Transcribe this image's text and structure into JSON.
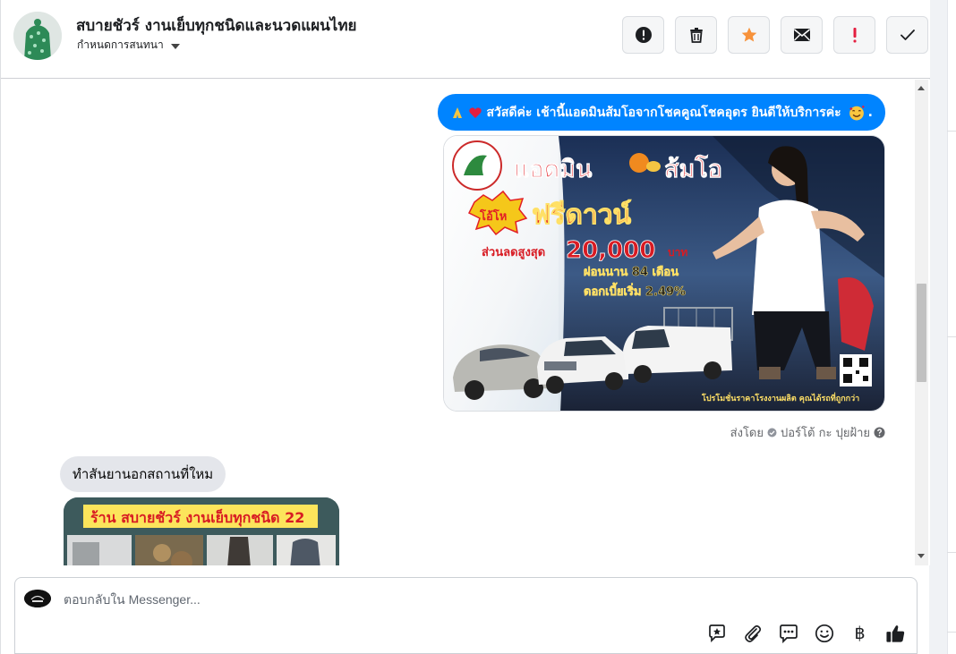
{
  "header": {
    "title": "สบายชัวร์ งานเย็บทุกชนิดและนวดแผนไทย",
    "subtitle": "กำหนดการสนทนา",
    "actions": [
      {
        "name": "alert-circle-icon"
      },
      {
        "name": "trash-icon"
      },
      {
        "name": "star-icon",
        "color": "#f7923b"
      },
      {
        "name": "mail-icon"
      },
      {
        "name": "exclamation-icon",
        "color": "#e41e3f"
      },
      {
        "name": "check-icon"
      }
    ]
  },
  "messages": {
    "outgoing_text": "สวัสดีค่ะ เช้านี้แอดมินส้มโอจากโชคคูณโชคอุดร ยินดีให้บริการค่ะ",
    "outgoing_suffix": ".",
    "promo": {
      "line1": "แอดมิน",
      "line1b": "ส้มโอ",
      "badge": "โอ้โห",
      "line2": "ฟรีดาวน์",
      "discount_label": "ส่วนลดสูงสุด",
      "discount_value": "20,000",
      "discount_unit": "บาท",
      "installment": "ผ่อนนาน 84 เดือน",
      "interest": "ดอกเบี้ยเริ่ม 2.49%",
      "footer": "โปรโมชั่นราคาโรงงานผลิต คุณได้รถที่ถูกกว่า"
    },
    "sent_by_label": "ส่งโดย",
    "sent_by_name": "ปอร์โต้ กะ ปุยฝ้าย",
    "incoming_text": "ทำสันยานอกสถานที่ใหม",
    "shop_banner": "ร้าน สบายชัวร์ งานเย็บทุกชนิด 22"
  },
  "composer": {
    "placeholder": "ตอบกลับใน Messenger...",
    "tools": [
      "sticker-icon",
      "attach-icon",
      "saved-reply-icon",
      "emoji-icon",
      "baht-icon",
      "thumbs-up-icon"
    ],
    "baht_symbol": "฿"
  },
  "colors": {
    "messenger_blue": "#0084ff",
    "incoming_grey": "#e4e6eb"
  }
}
